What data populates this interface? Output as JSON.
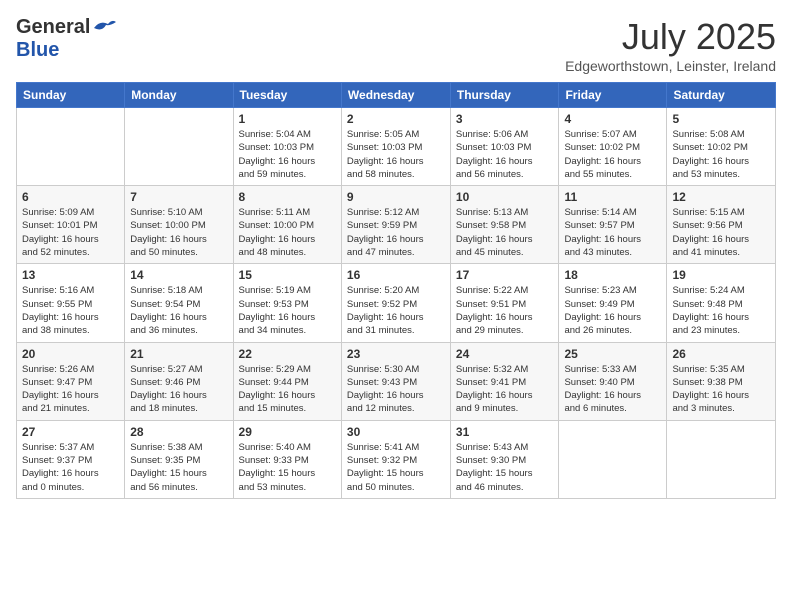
{
  "header": {
    "logo_general": "General",
    "logo_blue": "Blue",
    "month_title": "July 2025",
    "location": "Edgeworthstown, Leinster, Ireland"
  },
  "weekdays": [
    "Sunday",
    "Monday",
    "Tuesday",
    "Wednesday",
    "Thursday",
    "Friday",
    "Saturday"
  ],
  "weeks": [
    [
      {
        "day": "",
        "info": ""
      },
      {
        "day": "",
        "info": ""
      },
      {
        "day": "1",
        "info": "Sunrise: 5:04 AM\nSunset: 10:03 PM\nDaylight: 16 hours\nand 59 minutes."
      },
      {
        "day": "2",
        "info": "Sunrise: 5:05 AM\nSunset: 10:03 PM\nDaylight: 16 hours\nand 58 minutes."
      },
      {
        "day": "3",
        "info": "Sunrise: 5:06 AM\nSunset: 10:03 PM\nDaylight: 16 hours\nand 56 minutes."
      },
      {
        "day": "4",
        "info": "Sunrise: 5:07 AM\nSunset: 10:02 PM\nDaylight: 16 hours\nand 55 minutes."
      },
      {
        "day": "5",
        "info": "Sunrise: 5:08 AM\nSunset: 10:02 PM\nDaylight: 16 hours\nand 53 minutes."
      }
    ],
    [
      {
        "day": "6",
        "info": "Sunrise: 5:09 AM\nSunset: 10:01 PM\nDaylight: 16 hours\nand 52 minutes."
      },
      {
        "day": "7",
        "info": "Sunrise: 5:10 AM\nSunset: 10:00 PM\nDaylight: 16 hours\nand 50 minutes."
      },
      {
        "day": "8",
        "info": "Sunrise: 5:11 AM\nSunset: 10:00 PM\nDaylight: 16 hours\nand 48 minutes."
      },
      {
        "day": "9",
        "info": "Sunrise: 5:12 AM\nSunset: 9:59 PM\nDaylight: 16 hours\nand 47 minutes."
      },
      {
        "day": "10",
        "info": "Sunrise: 5:13 AM\nSunset: 9:58 PM\nDaylight: 16 hours\nand 45 minutes."
      },
      {
        "day": "11",
        "info": "Sunrise: 5:14 AM\nSunset: 9:57 PM\nDaylight: 16 hours\nand 43 minutes."
      },
      {
        "day": "12",
        "info": "Sunrise: 5:15 AM\nSunset: 9:56 PM\nDaylight: 16 hours\nand 41 minutes."
      }
    ],
    [
      {
        "day": "13",
        "info": "Sunrise: 5:16 AM\nSunset: 9:55 PM\nDaylight: 16 hours\nand 38 minutes."
      },
      {
        "day": "14",
        "info": "Sunrise: 5:18 AM\nSunset: 9:54 PM\nDaylight: 16 hours\nand 36 minutes."
      },
      {
        "day": "15",
        "info": "Sunrise: 5:19 AM\nSunset: 9:53 PM\nDaylight: 16 hours\nand 34 minutes."
      },
      {
        "day": "16",
        "info": "Sunrise: 5:20 AM\nSunset: 9:52 PM\nDaylight: 16 hours\nand 31 minutes."
      },
      {
        "day": "17",
        "info": "Sunrise: 5:22 AM\nSunset: 9:51 PM\nDaylight: 16 hours\nand 29 minutes."
      },
      {
        "day": "18",
        "info": "Sunrise: 5:23 AM\nSunset: 9:49 PM\nDaylight: 16 hours\nand 26 minutes."
      },
      {
        "day": "19",
        "info": "Sunrise: 5:24 AM\nSunset: 9:48 PM\nDaylight: 16 hours\nand 23 minutes."
      }
    ],
    [
      {
        "day": "20",
        "info": "Sunrise: 5:26 AM\nSunset: 9:47 PM\nDaylight: 16 hours\nand 21 minutes."
      },
      {
        "day": "21",
        "info": "Sunrise: 5:27 AM\nSunset: 9:46 PM\nDaylight: 16 hours\nand 18 minutes."
      },
      {
        "day": "22",
        "info": "Sunrise: 5:29 AM\nSunset: 9:44 PM\nDaylight: 16 hours\nand 15 minutes."
      },
      {
        "day": "23",
        "info": "Sunrise: 5:30 AM\nSunset: 9:43 PM\nDaylight: 16 hours\nand 12 minutes."
      },
      {
        "day": "24",
        "info": "Sunrise: 5:32 AM\nSunset: 9:41 PM\nDaylight: 16 hours\nand 9 minutes."
      },
      {
        "day": "25",
        "info": "Sunrise: 5:33 AM\nSunset: 9:40 PM\nDaylight: 16 hours\nand 6 minutes."
      },
      {
        "day": "26",
        "info": "Sunrise: 5:35 AM\nSunset: 9:38 PM\nDaylight: 16 hours\nand 3 minutes."
      }
    ],
    [
      {
        "day": "27",
        "info": "Sunrise: 5:37 AM\nSunset: 9:37 PM\nDaylight: 16 hours\nand 0 minutes."
      },
      {
        "day": "28",
        "info": "Sunrise: 5:38 AM\nSunset: 9:35 PM\nDaylight: 15 hours\nand 56 minutes."
      },
      {
        "day": "29",
        "info": "Sunrise: 5:40 AM\nSunset: 9:33 PM\nDaylight: 15 hours\nand 53 minutes."
      },
      {
        "day": "30",
        "info": "Sunrise: 5:41 AM\nSunset: 9:32 PM\nDaylight: 15 hours\nand 50 minutes."
      },
      {
        "day": "31",
        "info": "Sunrise: 5:43 AM\nSunset: 9:30 PM\nDaylight: 15 hours\nand 46 minutes."
      },
      {
        "day": "",
        "info": ""
      },
      {
        "day": "",
        "info": ""
      }
    ]
  ]
}
